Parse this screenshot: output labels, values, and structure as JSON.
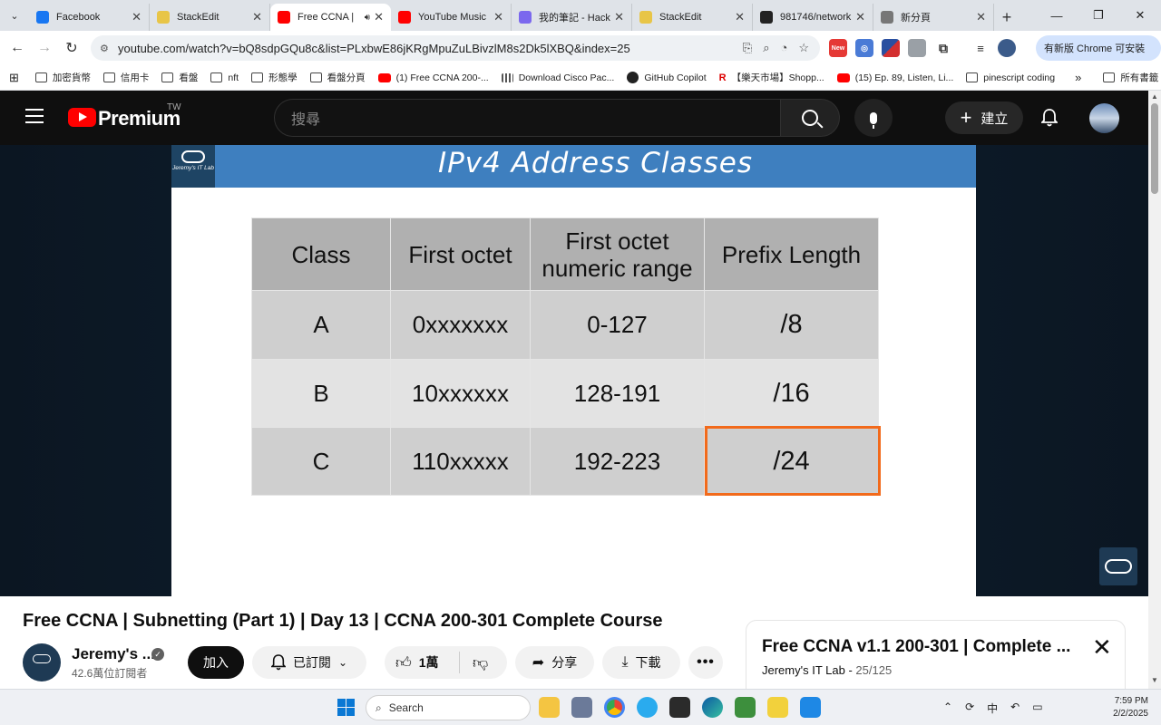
{
  "browser": {
    "tabs": [
      {
        "label": "Facebook",
        "color": "#1877f2",
        "active": false
      },
      {
        "label": "StackEdit",
        "color": "#e8c547",
        "active": false
      },
      {
        "label": "Free CCNA |",
        "color": "#ff0000",
        "active": true
      },
      {
        "label": "YouTube Music",
        "color": "#ff0000",
        "active": false
      },
      {
        "label": "我的筆記 - Hack",
        "color": "#7b68ee",
        "active": false
      },
      {
        "label": "StackEdit",
        "color": "#e8c547",
        "active": false
      },
      {
        "label": "981746/network",
        "color": "#222222",
        "active": false
      },
      {
        "label": "新分頁",
        "color": "#777777",
        "active": false
      }
    ],
    "url": "youtube.com/watch?v=bQ8sdpGQu8c&list=PLxbwE86jKRgMpuZuLBivzlM8s2Dk5lXBQ&index=25",
    "update_button": "有新版 Chrome 可安裝",
    "ext_new_badge": "New",
    "bookmarks": [
      {
        "label": "加密貨幣",
        "icon": "folder"
      },
      {
        "label": "信用卡",
        "icon": "folder"
      },
      {
        "label": "看盤",
        "icon": "folder"
      },
      {
        "label": "nft",
        "icon": "folder"
      },
      {
        "label": "形態學",
        "icon": "folder"
      },
      {
        "label": "看盤分頁",
        "icon": "folder"
      },
      {
        "label": "(1) Free CCNA 200-...",
        "icon": "yt"
      },
      {
        "label": "Download Cisco Pac...",
        "icon": "cisco"
      },
      {
        "label": "GitHub Copilot",
        "icon": "gh"
      },
      {
        "label": "【樂天市場】Shopp...",
        "icon": "r"
      },
      {
        "label": "(15) Ep. 89, Listen, Li...",
        "icon": "yt"
      },
      {
        "label": "pinescript coding",
        "icon": "folder"
      }
    ],
    "bookmarks_overflow": "»",
    "all_bookmarks": "所有書籤"
  },
  "youtube": {
    "brand": "Premium",
    "country": "TW",
    "search_placeholder": "搜尋",
    "create_label": "建立"
  },
  "slide": {
    "logo_text": "Jeremy's IT Lab",
    "title": "IPv4 Address Classes",
    "table": {
      "headers": [
        "Class",
        "First octet",
        "First octet numeric range",
        "Prefix Length"
      ],
      "rows": [
        [
          "A",
          "0xxxxxxx",
          "0-127",
          "/8"
        ],
        [
          "B",
          "10xxxxxx",
          "128-191",
          "/16"
        ],
        [
          "C",
          "110xxxxx",
          "192-223",
          "/24"
        ]
      ]
    }
  },
  "video": {
    "title": "Free CCNA | Subnetting (Part 1) | Day 13 | CCNA 200-301 Complete Course",
    "channel_name": "Jeremy's ...",
    "subscribers": "42.6萬位訂閱者",
    "join_label": "加入",
    "subscribed_label": "已訂閱",
    "likes": "1萬",
    "share_label": "分享",
    "download_label": "下載",
    "more_label": "•••"
  },
  "playlist": {
    "title": "Free CCNA v1.1 200-301 | Complete ...",
    "channel": "Jeremy's IT Lab",
    "position": "25/125"
  },
  "taskbar": {
    "search_label": "Search",
    "time": "7:59 PM",
    "date": "2/2/2025",
    "ime": "中"
  }
}
